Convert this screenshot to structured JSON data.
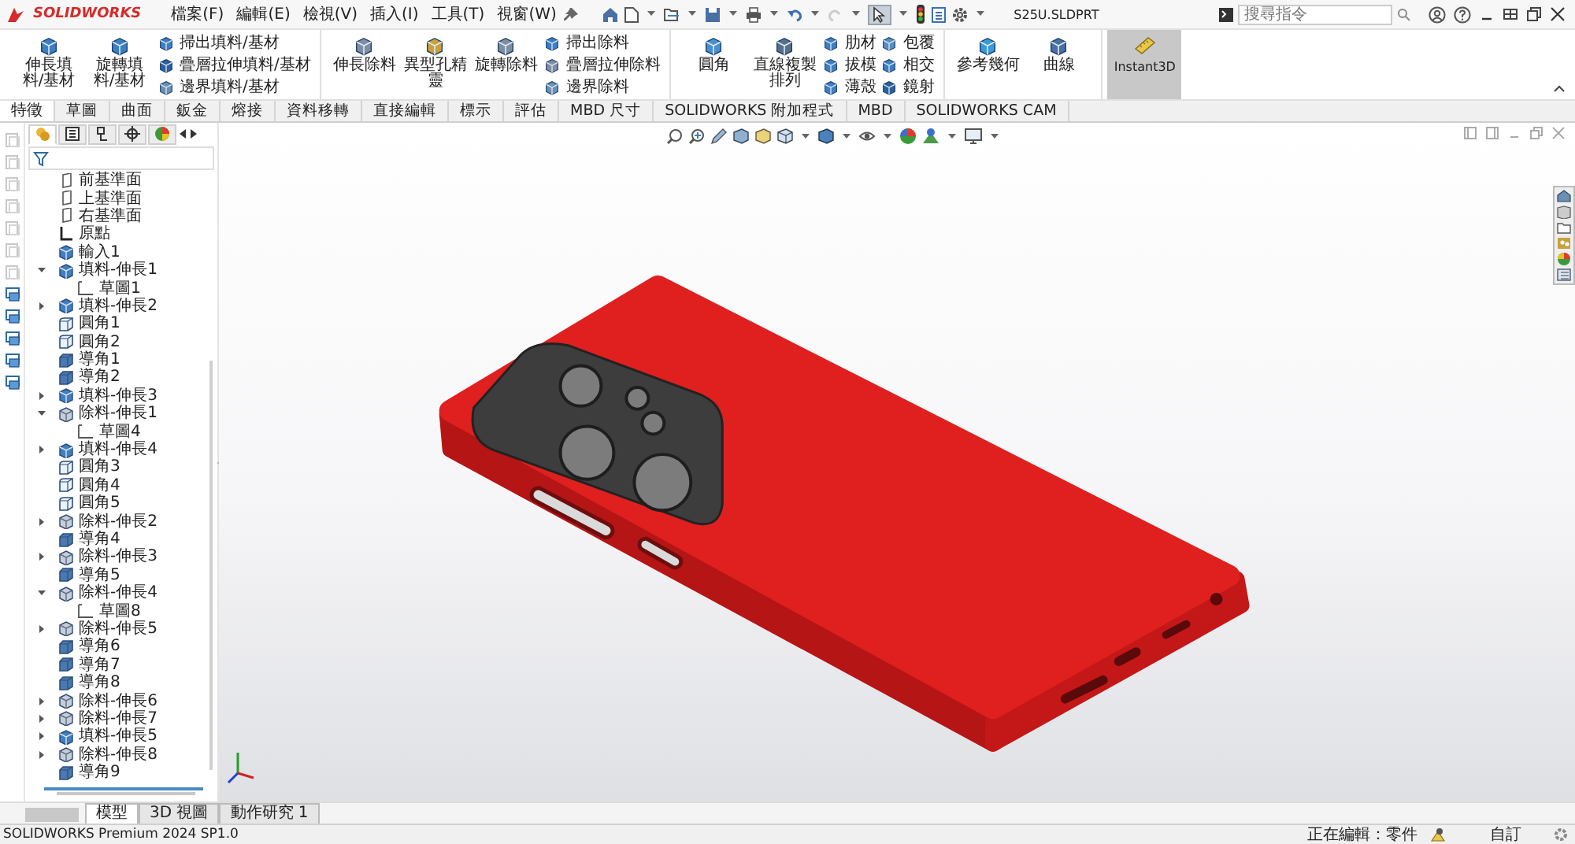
{
  "window": {
    "title": "S25U.SLDPRT"
  },
  "app_logo": "SOLIDWORKS",
  "menu": [
    "檔案(F)",
    "編輯(E)",
    "檢視(V)",
    "插入(I)",
    "工具(T)",
    "視窗(W)"
  ],
  "search": {
    "placeholder": "搜尋指令"
  },
  "ribbon": {
    "groups": [
      {
        "large": [
          {
            "label": "伸長填料/基材",
            "kind": "boss"
          },
          {
            "label": "旋轉填料/基材",
            "kind": "revolve"
          }
        ],
        "small_columns": [
          [
            {
              "label": "掃出填料/基材",
              "kind": "sweep"
            },
            {
              "label": "疊層拉伸填料/基材",
              "kind": "loft"
            },
            {
              "label": "邊界填料/基材",
              "kind": "boundary"
            }
          ]
        ]
      },
      {
        "large": [
          {
            "label": "伸長除料",
            "kind": "cut"
          },
          {
            "label": "異型孔精靈",
            "kind": "hole"
          },
          {
            "label": "旋轉除料",
            "kind": "cut"
          }
        ],
        "small_columns": [
          [
            {
              "label": "掃出除料",
              "kind": "sweep"
            },
            {
              "label": "疊層拉伸除料",
              "kind": "cut"
            },
            {
              "label": "邊界除料",
              "kind": "boundary"
            }
          ]
        ]
      },
      {
        "large": [
          {
            "label": "圓角",
            "kind": "fillet"
          },
          {
            "label": "直線複製排列",
            "kind": "pattern"
          }
        ],
        "small_columns": [
          [
            {
              "label": "肋材",
              "kind": "rib"
            },
            {
              "label": "拔模",
              "kind": "draft"
            },
            {
              "label": "薄殼",
              "kind": "shell"
            }
          ],
          [
            {
              "label": "包覆",
              "kind": "wrap"
            },
            {
              "label": "相交",
              "kind": "intersect"
            },
            {
              "label": "鏡射",
              "kind": "mirror"
            }
          ]
        ]
      },
      {
        "large": [
          {
            "label": "參考幾何",
            "kind": "reference"
          },
          {
            "label": "曲線",
            "kind": "curve"
          }
        ]
      }
    ],
    "toggle": {
      "label": "Instant3D",
      "on": true
    }
  },
  "ribbon_tabs": [
    {
      "label": "特徵",
      "selected": true
    },
    {
      "label": "草圖",
      "selected": false
    },
    {
      "label": "曲面",
      "selected": false
    },
    {
      "label": "鈑金",
      "selected": false
    },
    {
      "label": "熔接",
      "selected": false
    },
    {
      "label": "資料移轉",
      "selected": false
    },
    {
      "label": "直接編輯",
      "selected": false
    },
    {
      "label": "標示",
      "selected": false
    },
    {
      "label": "評估",
      "selected": false
    },
    {
      "label": "MBD 尺寸",
      "selected": false
    },
    {
      "label": "SOLIDWORKS 附加程式",
      "selected": false
    },
    {
      "label": "MBD",
      "selected": false
    },
    {
      "label": "SOLIDWORKS CAM",
      "selected": false
    }
  ],
  "feature_tree": {
    "tabs": [
      {
        "kind": "features",
        "selected": true
      },
      {
        "kind": "properties",
        "selected": false
      },
      {
        "kind": "configurations",
        "selected": false
      },
      {
        "kind": "dimxpert",
        "selected": false
      },
      {
        "kind": "display",
        "selected": false
      }
    ],
    "items": [
      {
        "label": "前基準面",
        "kind": "plane"
      },
      {
        "label": "上基準面",
        "kind": "plane"
      },
      {
        "label": "右基準面",
        "kind": "plane"
      },
      {
        "label": "原點",
        "kind": "origin"
      },
      {
        "label": "輸入1",
        "kind": "import"
      },
      {
        "label": "填料-伸長1",
        "kind": "boss",
        "expanded": true,
        "children": [
          {
            "label": "草圖1",
            "kind": "sketch"
          }
        ]
      },
      {
        "label": "填料-伸長2",
        "kind": "boss",
        "expanded": false
      },
      {
        "label": "圓角1",
        "kind": "fillet"
      },
      {
        "label": "圓角2",
        "kind": "fillet"
      },
      {
        "label": "導角1",
        "kind": "chamfer"
      },
      {
        "label": "導角2",
        "kind": "chamfer"
      },
      {
        "label": "填料-伸長3",
        "kind": "boss",
        "expanded": false
      },
      {
        "label": "除料-伸長1",
        "kind": "cut",
        "expanded": true,
        "children": [
          {
            "label": "草圖4",
            "kind": "sketch"
          }
        ]
      },
      {
        "label": "填料-伸長4",
        "kind": "boss",
        "expanded": false
      },
      {
        "label": "圓角3",
        "kind": "fillet"
      },
      {
        "label": "圓角4",
        "kind": "fillet"
      },
      {
        "label": "圓角5",
        "kind": "fillet"
      },
      {
        "label": "除料-伸長2",
        "kind": "cut",
        "expanded": false
      },
      {
        "label": "導角4",
        "kind": "chamfer"
      },
      {
        "label": "除料-伸長3",
        "kind": "cut",
        "expanded": false
      },
      {
        "label": "導角5",
        "kind": "chamfer"
      },
      {
        "label": "除料-伸長4",
        "kind": "cut",
        "expanded": true,
        "children": [
          {
            "label": "草圖8",
            "kind": "sketch"
          }
        ]
      },
      {
        "label": "除料-伸長5",
        "kind": "cut",
        "expanded": false
      },
      {
        "label": "導角6",
        "kind": "chamfer"
      },
      {
        "label": "導角7",
        "kind": "chamfer"
      },
      {
        "label": "導角8",
        "kind": "chamfer"
      },
      {
        "label": "除料-伸長6",
        "kind": "cut",
        "expanded": false
      },
      {
        "label": "除料-伸長7",
        "kind": "cut",
        "expanded": false
      },
      {
        "label": "填料-伸長5",
        "kind": "boss",
        "expanded": false
      },
      {
        "label": "除料-伸長8",
        "kind": "cut",
        "expanded": false
      },
      {
        "label": "導角9",
        "kind": "chamfer"
      }
    ]
  },
  "view_tabs": [
    {
      "label": "模型",
      "selected": true
    },
    {
      "label": "3D 視圖",
      "selected": false
    },
    {
      "label": "動作研究 1",
      "selected": false
    }
  ],
  "status_bar": {
    "product": "SOLIDWORKS Premium 2024 SP1.0",
    "mode": "正在編輯：零件",
    "units": "自訂"
  }
}
